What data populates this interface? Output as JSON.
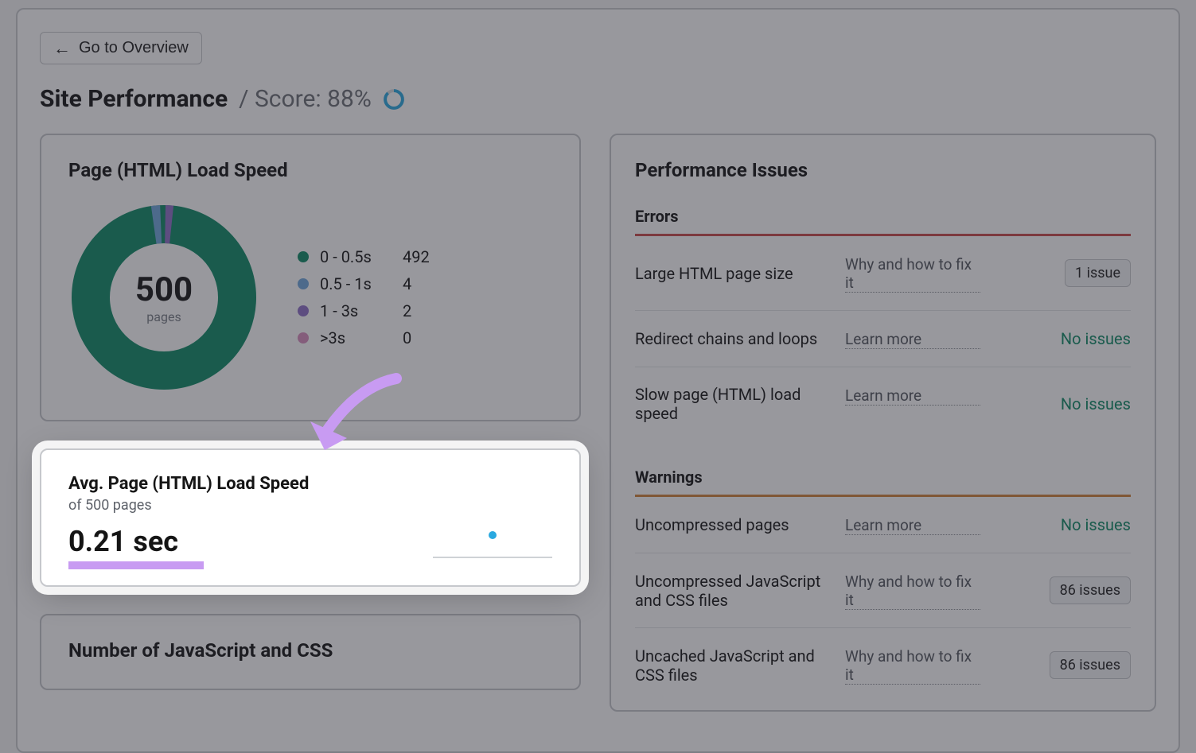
{
  "back_label": "Go to Overview",
  "title": "Site Performance",
  "score_label": "/  Score: 88%",
  "chart_data": {
    "type": "pie",
    "title": "Page (HTML) Load Speed",
    "center_value": "500",
    "center_label": "pages",
    "series": [
      {
        "name": "0 - 0.5s",
        "value": 492,
        "color": "#0f8a66"
      },
      {
        "name": "0.5 - 1s",
        "value": 4,
        "color": "#6fa8dc"
      },
      {
        "name": "1 - 3s",
        "value": 2,
        "color": "#8f6fc7"
      },
      {
        "name": ">3s",
        "value": 0,
        "color": "#d98fbf"
      }
    ]
  },
  "avg": {
    "heading": "Avg. Page (HTML) Load Speed",
    "sub": "of 500 pages",
    "value": "0.21 sec"
  },
  "jscss_heading": "Number of JavaScript and CSS",
  "issues": {
    "heading": "Performance Issues",
    "errors_label": "Errors",
    "warnings_label": "Warnings",
    "errors": [
      {
        "name": "Large HTML page size",
        "link": "Why and how to fix it",
        "status_type": "badge",
        "status": "1 issue"
      },
      {
        "name": "Redirect chains and loops",
        "link": "Learn more",
        "status_type": "none",
        "status": "No issues"
      },
      {
        "name": "Slow page (HTML) load speed",
        "link": "Learn more",
        "status_type": "none",
        "status": "No issues"
      }
    ],
    "warnings": [
      {
        "name": "Uncompressed pages",
        "link": "Learn more",
        "status_type": "none",
        "status": "No issues"
      },
      {
        "name": "Uncompressed JavaScript and CSS files",
        "link": "Why and how to fix it",
        "status_type": "badge",
        "status": "86 issues"
      },
      {
        "name": "Uncached JavaScript and CSS files",
        "link": "Why and how to fix it",
        "status_type": "badge",
        "status": "86 issues"
      }
    ]
  }
}
